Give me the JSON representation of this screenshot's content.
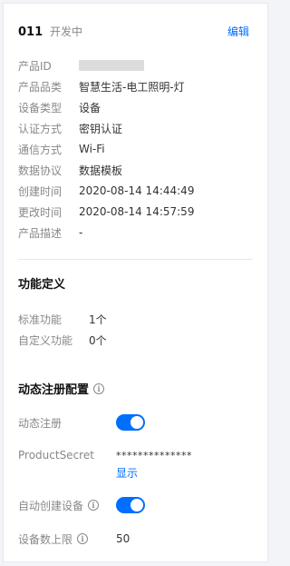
{
  "header": {
    "product_id": "011",
    "status": "开发中",
    "edit_label": "编辑"
  },
  "info": [
    {
      "label": "产品ID",
      "value": ""
    },
    {
      "label": "产品品类",
      "value": "智慧生活-电工照明-灯"
    },
    {
      "label": "设备类型",
      "value": "设备"
    },
    {
      "label": "认证方式",
      "value": "密钥认证"
    },
    {
      "label": "通信方式",
      "value": "Wi-Fi"
    },
    {
      "label": "数据协议",
      "value": "数据模板"
    },
    {
      "label": "创建时间",
      "value": "2020-08-14 14:44:49"
    },
    {
      "label": "更改时间",
      "value": "2020-08-14 14:57:59"
    },
    {
      "label": "产品描述",
      "value": "-"
    }
  ],
  "functions": {
    "title": "功能定义",
    "rows": [
      {
        "label": "标准功能",
        "value": "1个"
      },
      {
        "label": "自定义功能",
        "value": "0个"
      }
    ]
  },
  "dynamic_registration": {
    "title": "动态注册配置",
    "enable_label": "动态注册",
    "enabled": true,
    "secret_label": "ProductSecret",
    "secret_value": "**************",
    "show_label": "显示",
    "auto_create_label": "自动创建设备",
    "auto_create_enabled": true,
    "device_limit_label": "设备数上限",
    "device_limit_value": "50"
  },
  "colors": {
    "accent": "#006eff",
    "label": "#888888",
    "text": "#333333"
  }
}
